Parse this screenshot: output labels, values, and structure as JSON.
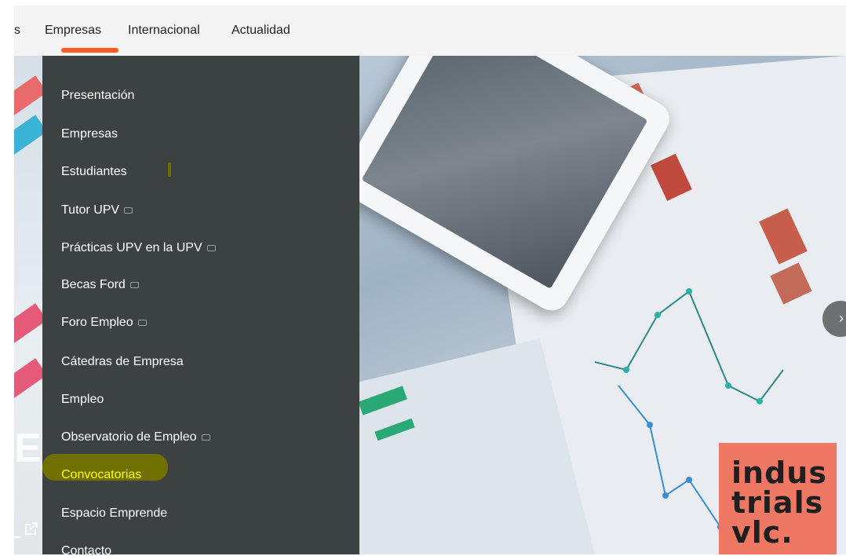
{
  "topnav": {
    "items": [
      {
        "label": "s"
      },
      {
        "label": "Empresas"
      },
      {
        "label": "Internacional"
      },
      {
        "label": "Actualidad"
      }
    ]
  },
  "menu": {
    "items": [
      {
        "label": "Presentación",
        "external": false
      },
      {
        "label": "Empresas",
        "external": false
      },
      {
        "label": "Estudiantes",
        "external": false
      },
      {
        "label": "Tutor UPV",
        "external": true
      },
      {
        "label": "Prácticas UPV en la UPV",
        "external": true
      },
      {
        "label": "Becas Ford",
        "external": true
      },
      {
        "label": "Foro Empleo",
        "external": true
      },
      {
        "label": "Cátedras de Empresa",
        "external": false
      },
      {
        "label": "Empleo",
        "external": false
      },
      {
        "label": "Observatorio de Empleo",
        "external": true
      },
      {
        "label": "Convocatorias",
        "external": false,
        "highlighted": true
      },
      {
        "label": "Espacio Emprende",
        "external": false
      },
      {
        "label": "Contacto",
        "external": false
      }
    ]
  },
  "hero": {
    "left_text": "ET",
    "logo": {
      "line1": "indus",
      "line2": "trials",
      "line3": "vlc."
    },
    "next_icon": "chevron-right-icon"
  },
  "colors": {
    "accent": "#ff5a1f",
    "menu_bg": "#3c4142",
    "highlight_text": "#ffff00",
    "logo_bg": "#ee7864"
  }
}
